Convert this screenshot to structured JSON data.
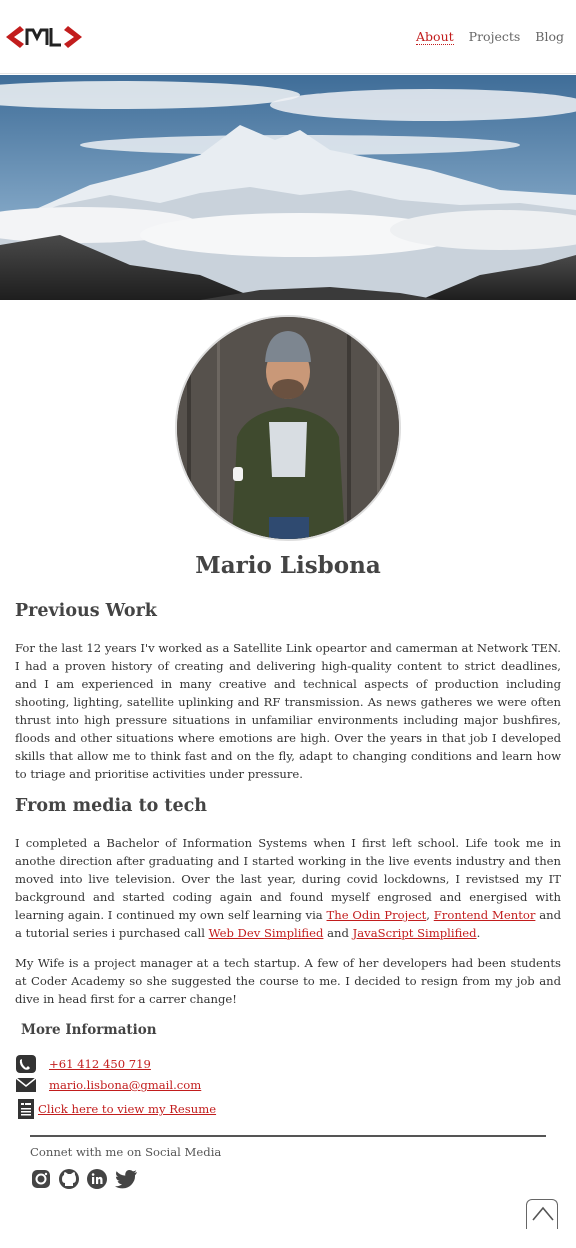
{
  "nav": {
    "items": [
      {
        "label": "About",
        "active": true
      },
      {
        "label": "Projects",
        "active": false
      },
      {
        "label": "Blog",
        "active": false
      }
    ]
  },
  "profile": {
    "name": "Mario Lisbona"
  },
  "sections": {
    "previous_work": {
      "title": "Previous Work",
      "text": "For the last 12 years I'v worked as a Satellite Link opeartor and camerman at Network TEN. I had a proven history of creating and delivering high-quality content to strict deadlines, and I am experienced in many creative and technical aspects of production including shooting, lighting, satellite uplinking and RF transmission. As news gatheres we were often thrust into high pressure situations in unfamiliar environments including major bushfires, floods and other situations where emotions are high. Over the years in that job I developed skills that allow me to think fast and on the fly, adapt to changing conditions and learn how to triage and prioritise activities under pressure."
    },
    "media_to_tech": {
      "title": "From media to tech",
      "text_1": "I completed a Bachelor of Information Systems when I first left school. Life took me in anothe direction after graduating and I started working in the live events industry and then moved into live television. Over the last year, during covid lockdowns, I revistsed my IT background and started coding again and found myself engrosed and energised with learning again. I continued my own self learning via ",
      "link_odin": "The Odin Project",
      "sep_1": ", ",
      "link_frontend": "Frontend Mentor",
      "text_2": " and a tutorial series i purchased call ",
      "link_webdev": "Web Dev Simplified",
      "sep_2": " and ",
      "link_js": "JavaScript Simplified",
      "end": ".",
      "para_2": "My Wife is a project manager at a tech startup. A few of her developers had been students at Coder Academy so she suggested the course to me. I decided to resign from my job and dive in head first for a carrer change!"
    },
    "more_info": {
      "title": "More Information",
      "phone": "+61 412 450 719",
      "email": "mario.lisbona@gmail.com",
      "resume": "Click here to view my Resume"
    }
  },
  "social": {
    "title": "Connet with me on Social Media",
    "icons": [
      "instagram-icon",
      "github-icon",
      "linkedin-icon",
      "twitter-icon"
    ]
  },
  "colors": {
    "accent": "#c21d1d",
    "text": "#333333"
  }
}
